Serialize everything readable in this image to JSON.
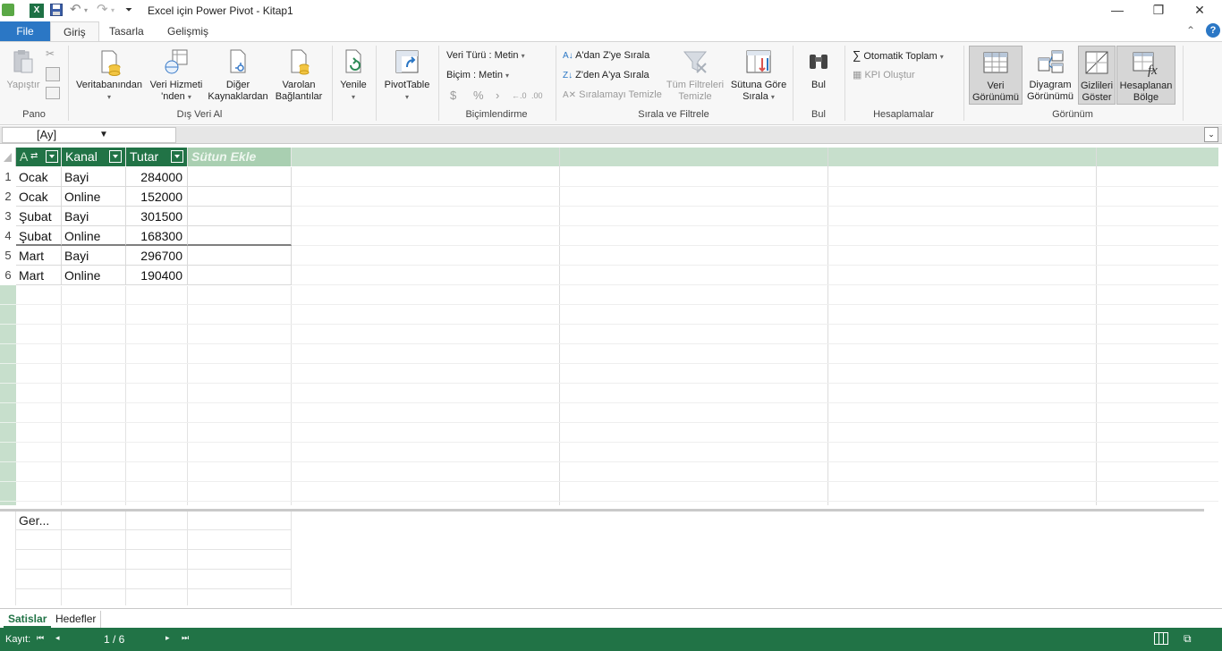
{
  "window": {
    "title": "Excel için Power Pivot - Kitap1",
    "minimize": "—",
    "restore": "❐",
    "close": "✕"
  },
  "tabs": {
    "file": "File",
    "giris": "Giriş",
    "tasarla": "Tasarla",
    "gelismis": "Gelişmiş"
  },
  "ribbon": {
    "pano": {
      "yapistir": "Yapıştır",
      "label": "Pano"
    },
    "dis_veri": {
      "veritabanindan": "Veritabanından",
      "veri_hizmeti_1": "Veri Hizmeti",
      "veri_hizmeti_2": "'nden",
      "diger_1": "Diğer",
      "diger_2": "Kaynaklardan",
      "varolan_1": "Varolan",
      "varolan_2": "Bağlantılar",
      "label": "Dış Veri Al"
    },
    "yenile": "Yenile",
    "pivottable": "PivotTable",
    "bicim": {
      "veri_turu": "Veri Türü : Metin",
      "bicim": "Biçim : Metin",
      "label": "Biçimlendirme"
    },
    "sirala": {
      "az": "A'dan Z'ye Sırala",
      "za": "Z'den A'ya Sırala",
      "temizle": "Sıralamayı Temizle",
      "tum_filtre_1": "Tüm Filtreleri",
      "tum_filtre_2": "Temizle",
      "sutuna_gore_1": "Sütuna Göre",
      "sutuna_gore_2": "Sırala",
      "label": "Sırala ve Filtrele"
    },
    "bul": {
      "bul": "Bul",
      "label": "Bul"
    },
    "hesap": {
      "otomatik": "Otomatik Toplam",
      "kpi": "KPI Oluştur",
      "label": "Hesaplamalar"
    },
    "gorunum": {
      "veri_1": "Veri",
      "veri_2": "Görünümü",
      "diyagram_1": "Diyagram",
      "diyagram_2": "Görünümü",
      "gizli_1": "Gizlileri",
      "gizli_2": "Göster",
      "hesap_1": "Hesaplanan",
      "hesap_2": "Bölge",
      "label": "Görünüm"
    }
  },
  "namebox": "[Ay]",
  "table": {
    "headers": [
      "A",
      "Kanal",
      "Tutar",
      "Sütun Ekle"
    ],
    "rows": [
      [
        "1",
        "Ocak",
        "Bayi",
        "284000"
      ],
      [
        "2",
        "Ocak",
        "Online",
        "152000"
      ],
      [
        "3",
        "Şubat",
        "Bayi",
        "301500"
      ],
      [
        "4",
        "Şubat",
        "Online",
        "168300"
      ],
      [
        "5",
        "Mart",
        "Bayi",
        "296700"
      ],
      [
        "6",
        "Mart",
        "Online",
        "190400"
      ]
    ]
  },
  "calc": {
    "cell": "Ger..."
  },
  "sheets": [
    "Satislar",
    "Hedefler"
  ],
  "status": {
    "kayit": "Kayıt:",
    "page": "1 / 6"
  },
  "colors": {
    "accent": "#217346",
    "file_tab": "#2b77c5",
    "header_green": "#c7dfcc"
  }
}
